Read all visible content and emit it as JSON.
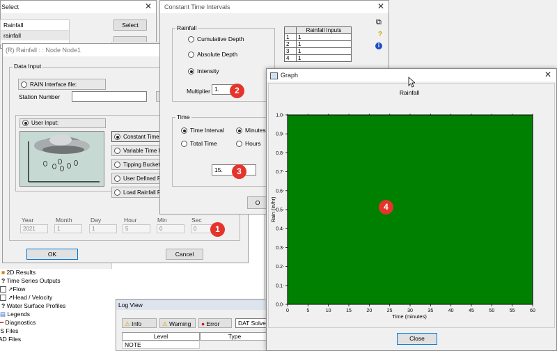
{
  "select_win": {
    "title": "Select",
    "items": [
      "Rainfall",
      "rainfall"
    ],
    "select_label": "Select"
  },
  "sidebar": {
    "items": [
      {
        "label": "2D Results",
        "icon": "folder-icon"
      },
      {
        "label": "Time Series Outputs",
        "icon": "question-icon"
      },
      {
        "label": "Flow",
        "icon": "chart-icon"
      },
      {
        "label": "Head / Velocity",
        "icon": "chart-icon"
      },
      {
        "label": "Water Surface Profiles",
        "icon": "question-icon"
      },
      {
        "label": "Legends",
        "icon": "legend-icon"
      },
      {
        "label": "Diagnostics",
        "icon": "diagnostic-icon"
      },
      {
        "label": "IS Files",
        "icon": "file-icon"
      },
      {
        "label": "AD Files",
        "icon": "file-icon"
      }
    ]
  },
  "log": {
    "title": "Log View",
    "info_label": "Info",
    "warning_label": "Warning",
    "error_label": "Error",
    "dropdown_value": "DAT Solve",
    "col_level": "Level",
    "col_type": "Type",
    "row_level": "NOTE"
  },
  "rain_dialog": {
    "title": "(R) Rainfall : : Node Node1",
    "data_input_label": "Data Input",
    "rain_file_label": "RAIN Interface file:",
    "station_label": "Station Number",
    "user_input_label": "User Input:",
    "options": [
      "Constant Time I",
      "Variable Time In",
      "Tipping Bucket G",
      "User Defined Ra",
      "Load Rainfall File"
    ],
    "date_labels": [
      "Year",
      "Month",
      "Day",
      "Hour",
      "Min",
      "Sec"
    ],
    "date_values": [
      "2021",
      "1",
      "1",
      "5",
      "0",
      "0"
    ],
    "ok_label": "OK",
    "cancel_label": "Cancel"
  },
  "cti_dialog": {
    "title": "Constant Time Intervals",
    "rainfall_group": "Rainfall",
    "cumulative": "Cumulative Depth",
    "absolute": "Absolute Depth",
    "intensity": "Intensity",
    "multiplier_label": "Multiplier",
    "multiplier_value": "1.",
    "time_group": "Time",
    "time_interval": "Time Interval",
    "total_time": "Total Time",
    "minutes": "Minutes",
    "hours": "Hours",
    "interval_value": "15.",
    "table_header": "Rainfall Inputs",
    "table_rows": [
      [
        "1",
        "1"
      ],
      [
        "2",
        "1"
      ],
      [
        "3",
        "1"
      ],
      [
        "4",
        "1"
      ]
    ],
    "ok_partial": "O"
  },
  "graph_win": {
    "title": "Graph",
    "close_label": "Close"
  },
  "badges": [
    "1",
    "2",
    "3",
    "4"
  ],
  "chart_data": {
    "type": "area",
    "title": "Rainfall",
    "xlabel": "Time  (minutes)",
    "ylabel": "Rain (in/hr)",
    "xlim": [
      0,
      60
    ],
    "ylim": [
      0,
      1
    ],
    "x": [
      0,
      60
    ],
    "y": [
      1,
      1
    ],
    "xticks": [
      "0",
      "5",
      "10",
      "15",
      "20",
      "25",
      "30",
      "35",
      "40",
      "45",
      "50",
      "55",
      "60"
    ],
    "yticks": [
      "0.0",
      "0.1",
      "0.2",
      "0.3",
      "0.4",
      "0.5",
      "0.6",
      "0.7",
      "0.8",
      "0.9",
      "1.0"
    ],
    "fill_color": "#008000"
  },
  "colors": {
    "badge": "#e4342b",
    "fill": "#008000"
  }
}
